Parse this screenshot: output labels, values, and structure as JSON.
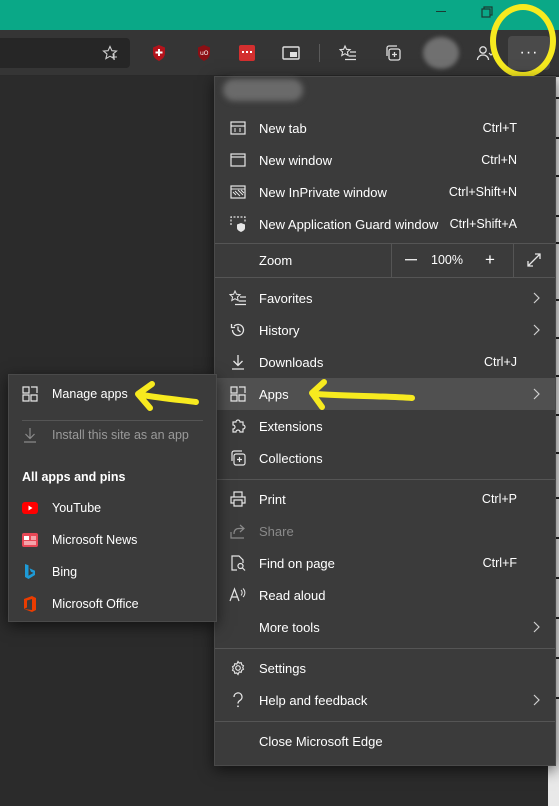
{
  "menu": {
    "items": [
      {
        "label": "New tab",
        "shortcut": "Ctrl+T"
      },
      {
        "label": "New window",
        "shortcut": "Ctrl+N"
      },
      {
        "label": "New InPrivate window",
        "shortcut": "Ctrl+Shift+N"
      },
      {
        "label": "New Application Guard window",
        "shortcut": "Ctrl+Shift+A"
      }
    ],
    "zoom": {
      "label": "Zoom",
      "minus": "—",
      "value": "100%",
      "plus": "+"
    },
    "nav_items": [
      {
        "label": "Favorites"
      },
      {
        "label": "History"
      },
      {
        "label": "Downloads",
        "shortcut": "Ctrl+J"
      },
      {
        "label": "Apps"
      },
      {
        "label": "Extensions"
      },
      {
        "label": "Collections"
      }
    ],
    "tool_items": [
      {
        "label": "Print",
        "shortcut": "Ctrl+P"
      },
      {
        "label": "Share"
      },
      {
        "label": "Find on page",
        "shortcut": "Ctrl+F"
      },
      {
        "label": "Read aloud"
      },
      {
        "label": "More tools"
      }
    ],
    "help_items": [
      {
        "label": "Settings"
      },
      {
        "label": "Help and feedback"
      }
    ],
    "close_label": "Close Microsoft Edge"
  },
  "apps_submenu": {
    "manage": "Manage apps",
    "install": "Install this site as an app",
    "heading": "All apps and pins",
    "apps": [
      {
        "label": "YouTube"
      },
      {
        "label": "Microsoft News"
      },
      {
        "label": "Bing"
      },
      {
        "label": "Microsoft Office"
      }
    ]
  },
  "toolbar": {
    "more_label": "···"
  },
  "colors": {
    "annotation": "#f7ea1f",
    "titlebar": "#0aa887"
  }
}
